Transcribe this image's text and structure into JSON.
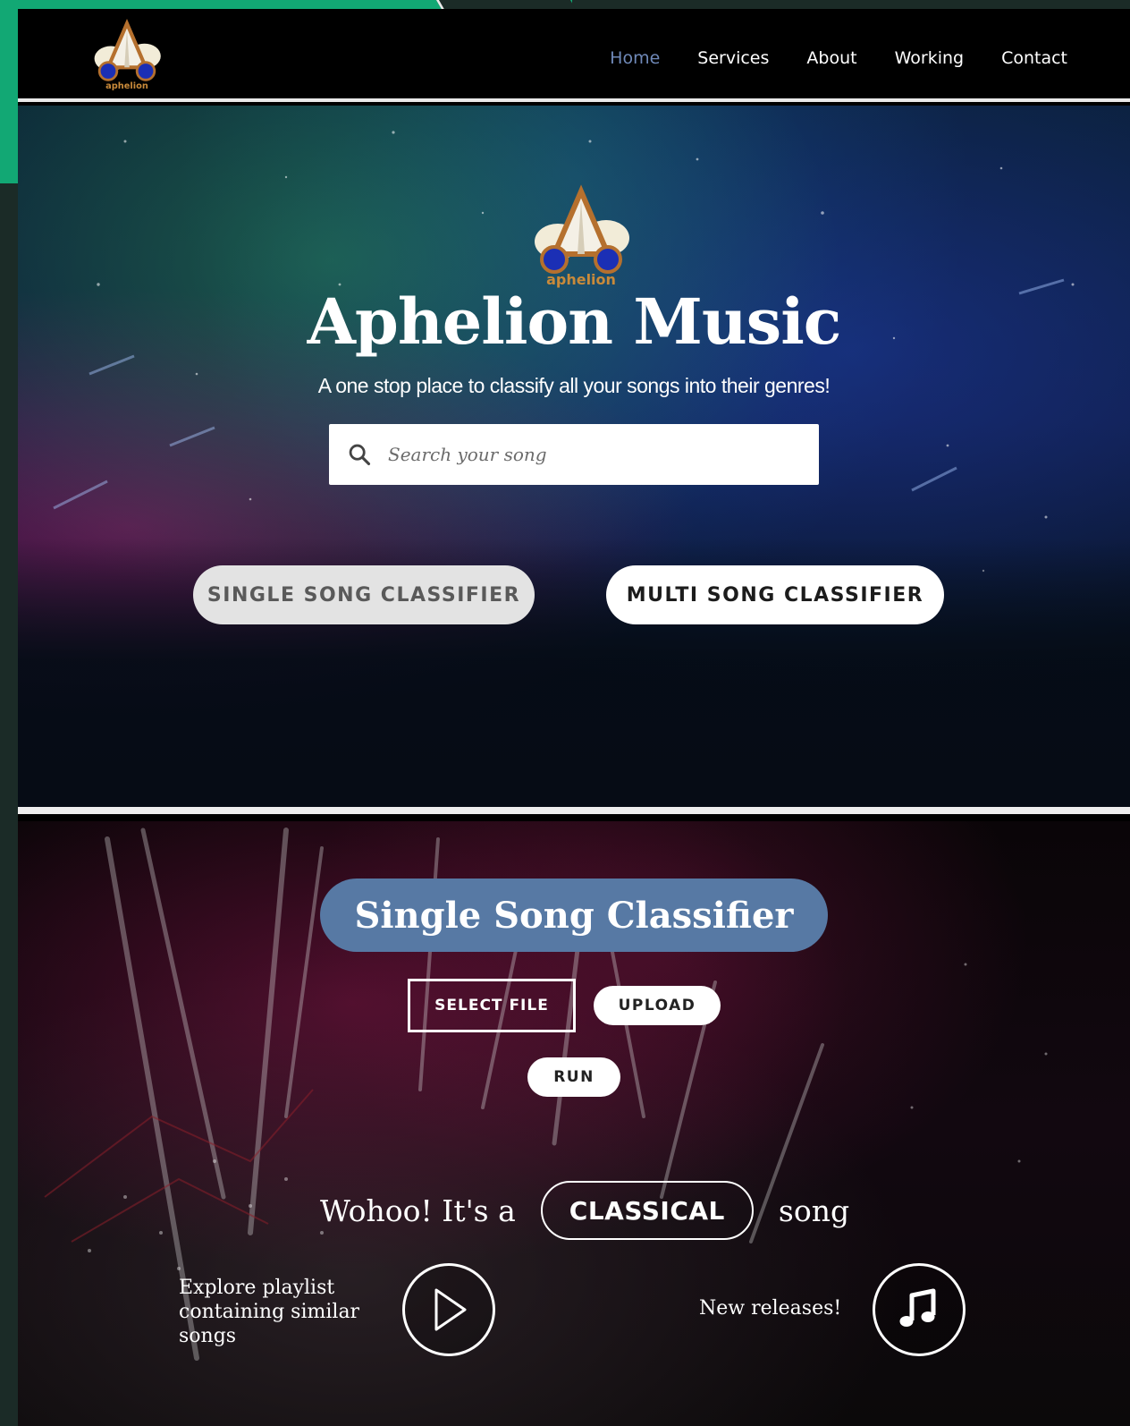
{
  "nav": {
    "logo_text": "aphelion",
    "links": [
      "Home",
      "Services",
      "About",
      "Working",
      "Contact"
    ],
    "active": "Home"
  },
  "hero": {
    "logo_text": "aphelion",
    "title": "Aphelion Music",
    "subtitle": "A one stop place to classify all your songs into their genres!",
    "search": {
      "placeholder": "Search your song",
      "value": ""
    },
    "buttons": {
      "single": "SINGLE SONG CLASSIFIER",
      "multi": "MULTI SONG CLASSIFIER"
    }
  },
  "classifier": {
    "title": "Single Song Classifier",
    "select_file": "SELECT FILE",
    "upload": "UPLOAD",
    "run": "RUN",
    "result_prefix": "Wohoo! It's a",
    "genre": "CLASSICAL",
    "result_suffix": "song",
    "explore": "Explore playlist containing similar songs",
    "new_releases": "New releases!"
  },
  "icons": {
    "search": "search-icon",
    "play": "play-icon",
    "music": "music-note-icon",
    "logo": "aphelion-logo"
  },
  "colors": {
    "accent_green": "#12a874",
    "active_nav": "#6f89b8",
    "classifier_title_bg": "#5779a4"
  }
}
